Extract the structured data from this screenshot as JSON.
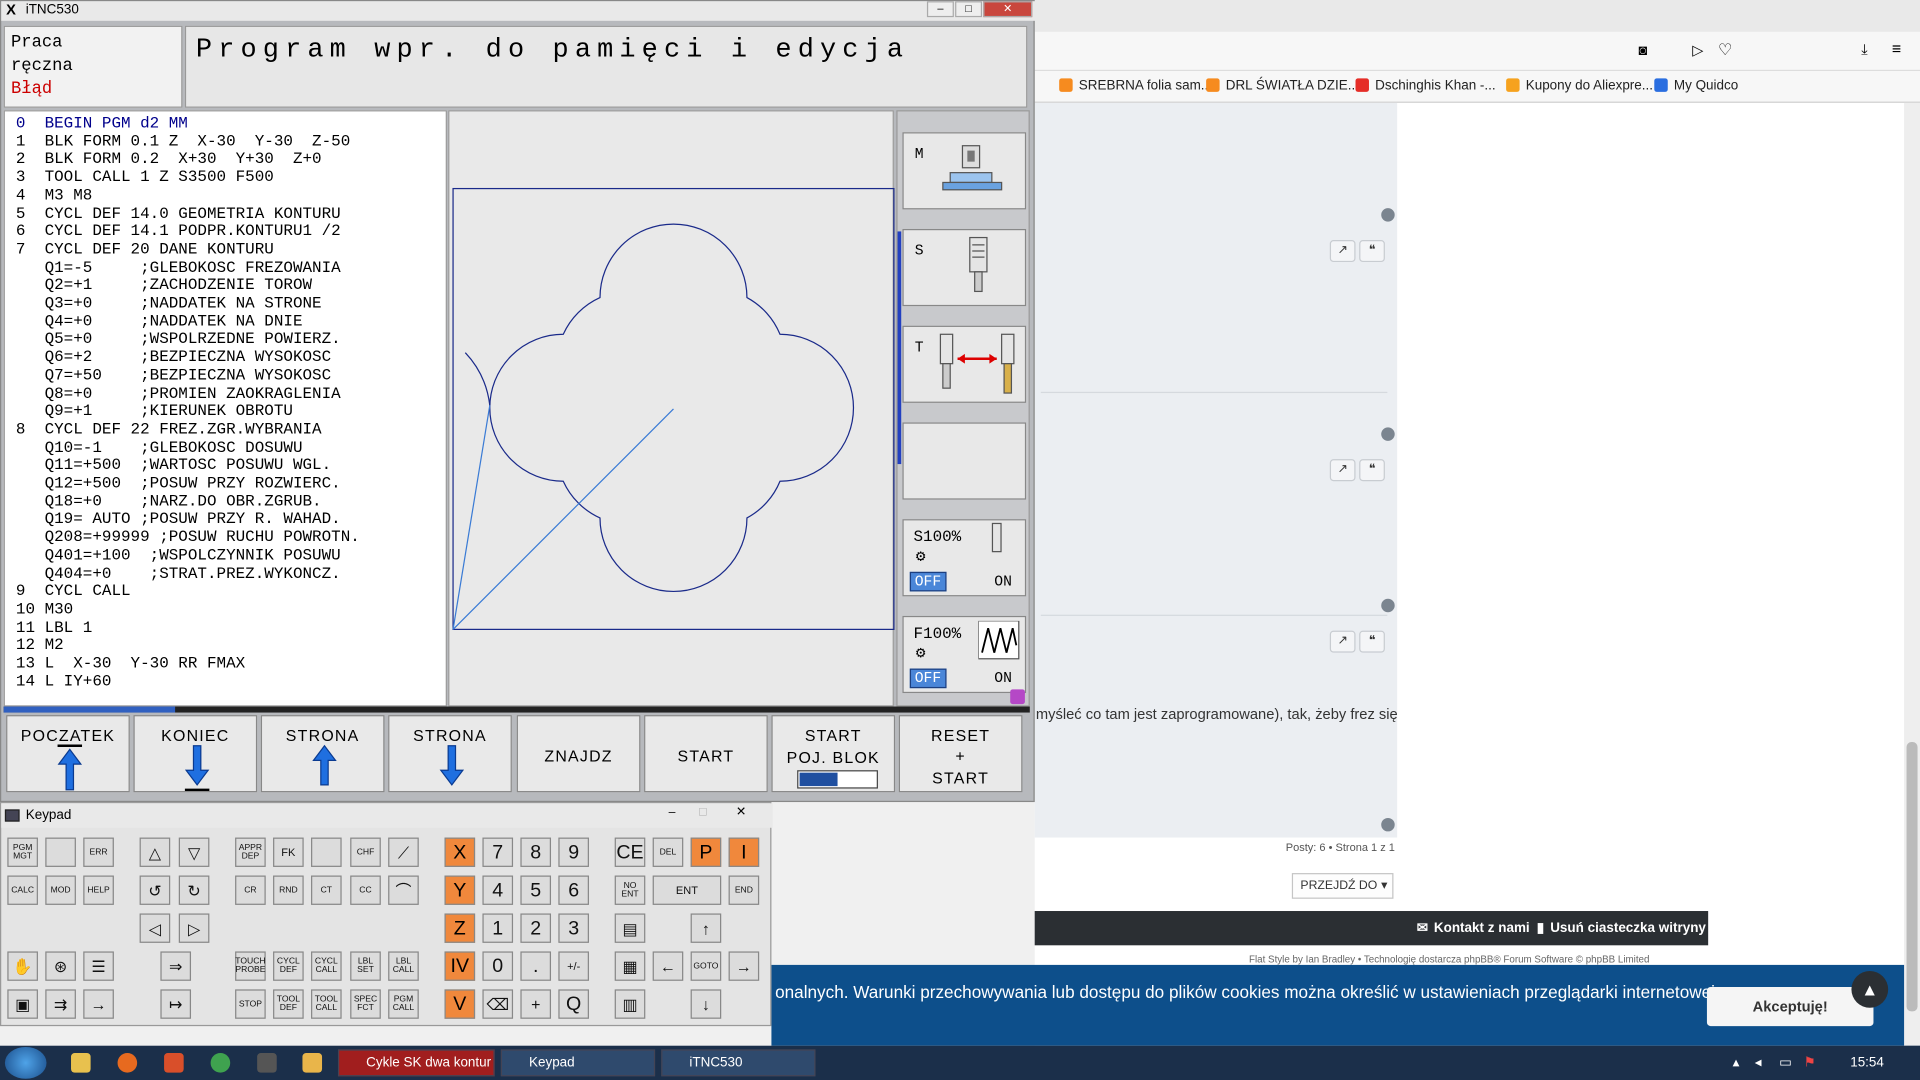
{
  "window": {
    "title": "iTNC530",
    "min": "–",
    "max": "□",
    "close": "✕"
  },
  "header": {
    "mode_line1": "Praca",
    "mode_line2": "ręczna",
    "mode_error": "Błąd",
    "title": "Program wpr. do pamięci i edycja"
  },
  "program_lines": [
    "0  BEGIN PGM d2 MM",
    "1  BLK FORM 0.1 Z  X-30  Y-30  Z-50",
    "2  BLK FORM 0.2  X+30  Y+30  Z+0",
    "3  TOOL CALL 1 Z S3500 F500",
    "4  M3 M8",
    "5  CYCL DEF 14.0 GEOMETRIA KONTURU",
    "6  CYCL DEF 14.1 PODPR.KONTURU1 /2",
    "7  CYCL DEF 20 DANE KONTURU",
    "   Q1=-5     ;GLEBOKOSC FREZOWANIA",
    "   Q2=+1     ;ZACHODZENIE TOROW",
    "   Q3=+0     ;NADDATEK NA STRONE",
    "   Q4=+0     ;NADDATEK NA DNIE",
    "   Q5=+0     ;WSPOLRZEDNE POWIERZ.",
    "   Q6=+2     ;BEZPIECZNA WYSOKOSC",
    "   Q7=+50    ;BEZPIECZNA WYSOKOSC",
    "   Q8=+0     ;PROMIEN ZAOKRAGLENIA",
    "   Q9=+1     ;KIERUNEK OBROTU",
    "8  CYCL DEF 22 FREZ.ZGR.WYBRANIA",
    "   Q10=-1    ;GLEBOKOSC DOSUWU",
    "   Q11=+500  ;WARTOSC POSUWU WGL.",
    "   Q12=+500  ;POSUW PRZY ROZWIERC.",
    "   Q18=+0    ;NARZ.DO OBR.ZGRUB.",
    "   Q19= AUTO ;POSUW PRZY R. WAHAD.",
    "   Q208=+99999 ;POSUW RUCHU POWROTN.",
    "   Q401=+100  ;WSPOLCZYNNIK POSUWU",
    "   Q404=+0    ;STRAT.PREZ.WYKONCZ.",
    "9  CYCL CALL",
    "10 M30",
    "11 LBL 1",
    "12 M2",
    "13 L  X-30  Y-30 RR FMAX",
    "14 L IY+60"
  ],
  "side_keys": {
    "m": "M",
    "s": "S",
    "t": "T",
    "s_override": "S100%",
    "f_override": "F100%",
    "off": "OFF",
    "on": "ON"
  },
  "softkeys": {
    "start_label": "POCZATEK",
    "end_label": "KONIEC",
    "page_up_label": "STRONA",
    "page_down_label": "STRONA",
    "find_label": "ZNAJDZ",
    "run_label": "START",
    "block_l1": "START",
    "block_l2": "POJ. BLOK",
    "reset_l1": "RESET",
    "reset_l2": "+",
    "reset_l3": "START"
  },
  "keypad": {
    "title": "Keypad",
    "pgm_mgt": "PGM MGT",
    "err": "ERR",
    "calc": "CALC",
    "mod": "MOD",
    "help": "HELP",
    "appr": "APPR DEP",
    "fk": "FK",
    "chf": "CHF",
    "cr": "CR",
    "rnd": "RND",
    "ct": "CT",
    "cc": "CC",
    "touch": "TOUCH PROBE",
    "cycl_def": "CYCL DEF",
    "cycl_call": "CYCL CALL",
    "lbl_set": "LBL SET",
    "lbl_call": "LBL CALL",
    "stop": "STOP",
    "tool_def": "TOOL DEF",
    "tool_call": "TOOL CALL",
    "spec_fct": "SPEC FCT",
    "pgm_call": "PGM CALL",
    "x": "X",
    "y": "Y",
    "z": "Z",
    "iv": "IV",
    "v": "V",
    "p": "P",
    "i": "I",
    "q": "Q",
    "n7": "7",
    "n8": "8",
    "n9": "9",
    "n4": "4",
    "n5": "5",
    "n6": "6",
    "n1": "1",
    "n2": "2",
    "n3": "3",
    "n0": "0",
    "dot": ".",
    "pm": "+/-",
    "ce": "CE",
    "del": "DEL",
    "no_ent": "NO ENT",
    "ent": "ENT",
    "end": "END",
    "goto": "GOTO"
  },
  "browser": {
    "bookmarks": [
      "SREBRNA folia sam...",
      "DRL ŚWIATŁA DZIE...",
      "Dschinghis Khan -...",
      "Kupony do Aliexpre...",
      "My Quidco"
    ],
    "post_text": "myśleć co tam jest zaprogramowane), tak, żeby frez się",
    "pager": "Posty: 6 • Strona 1 z 1",
    "jump": "PRZEJDŹ DO",
    "contact": "Kontakt z nami",
    "cookies_del": "Usuń ciasteczka witryny",
    "credit": "Flat Style by Ian Bradley • Technologię dostarcza phpBB® Forum Software © phpBB Limited",
    "cookie_msg": "onalnych. Warunki przechowywania lub dostępu do plików cookies można określić w ustawieniach przeglądarki internetowej.",
    "accept": "Akceptuję!"
  },
  "taskbar": {
    "items": [
      "Cykle SK dwa kontur ...",
      "Keypad",
      "iTNC530"
    ],
    "clock": "15:54"
  }
}
